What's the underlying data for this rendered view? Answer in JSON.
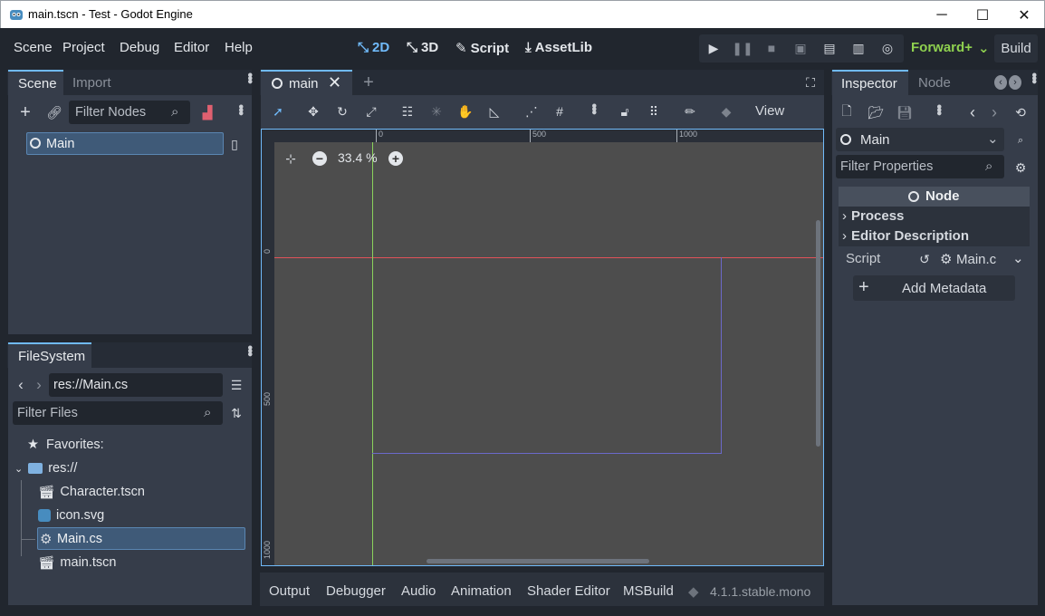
{
  "window": {
    "title": "main.tscn - Test - Godot Engine",
    "controls": [
      "─",
      "☐",
      "✕"
    ]
  },
  "menu": {
    "items": [
      "Scene",
      "Project",
      "Debug",
      "Editor",
      "Help"
    ]
  },
  "workspaces": {
    "d2": "2D",
    "d3": "3D",
    "script": "Script",
    "assetlib": "AssetLib"
  },
  "renderer": {
    "label": "Forward+",
    "build": "Build"
  },
  "scene_dock": {
    "tab_scene": "Scene",
    "tab_import": "Import",
    "filter_placeholder": "Filter Nodes",
    "root_node": "Main"
  },
  "filesystem_dock": {
    "tab": "FileSystem",
    "path": "res://Main.cs",
    "filter_placeholder": "Filter Files",
    "favorites": "Favorites:",
    "root": "res://",
    "files": [
      "Character.tscn",
      "icon.svg",
      "Main.cs",
      "main.tscn"
    ]
  },
  "viewport": {
    "tab": "main",
    "view_menu": "View",
    "zoom": "33.4 %",
    "ruler_h": [
      "0",
      "500",
      "1000"
    ],
    "ruler_v": [
      "0",
      "500",
      "1000"
    ]
  },
  "bottom_panel": {
    "tabs": [
      "Output",
      "Debugger",
      "Audio",
      "Animation",
      "Shader Editor",
      "MSBuild"
    ],
    "version": "4.1.1.stable.mono"
  },
  "inspector": {
    "tab_inspector": "Inspector",
    "tab_node": "Node",
    "object": "Main",
    "filter_placeholder": "Filter Properties",
    "class_header": "Node",
    "sections": [
      "Process",
      "Editor Description"
    ],
    "script_label": "Script",
    "script_value": "Main.c",
    "add_metadata": "Add Metadata"
  },
  "colors": {
    "accent": "#70bafa",
    "renderer": "#8fd14f",
    "canvas_bg": "#4d4d4d",
    "x_axis": "#e0525a",
    "y_axis": "#8ad25c",
    "viewport_rect": "#6b69c9"
  }
}
